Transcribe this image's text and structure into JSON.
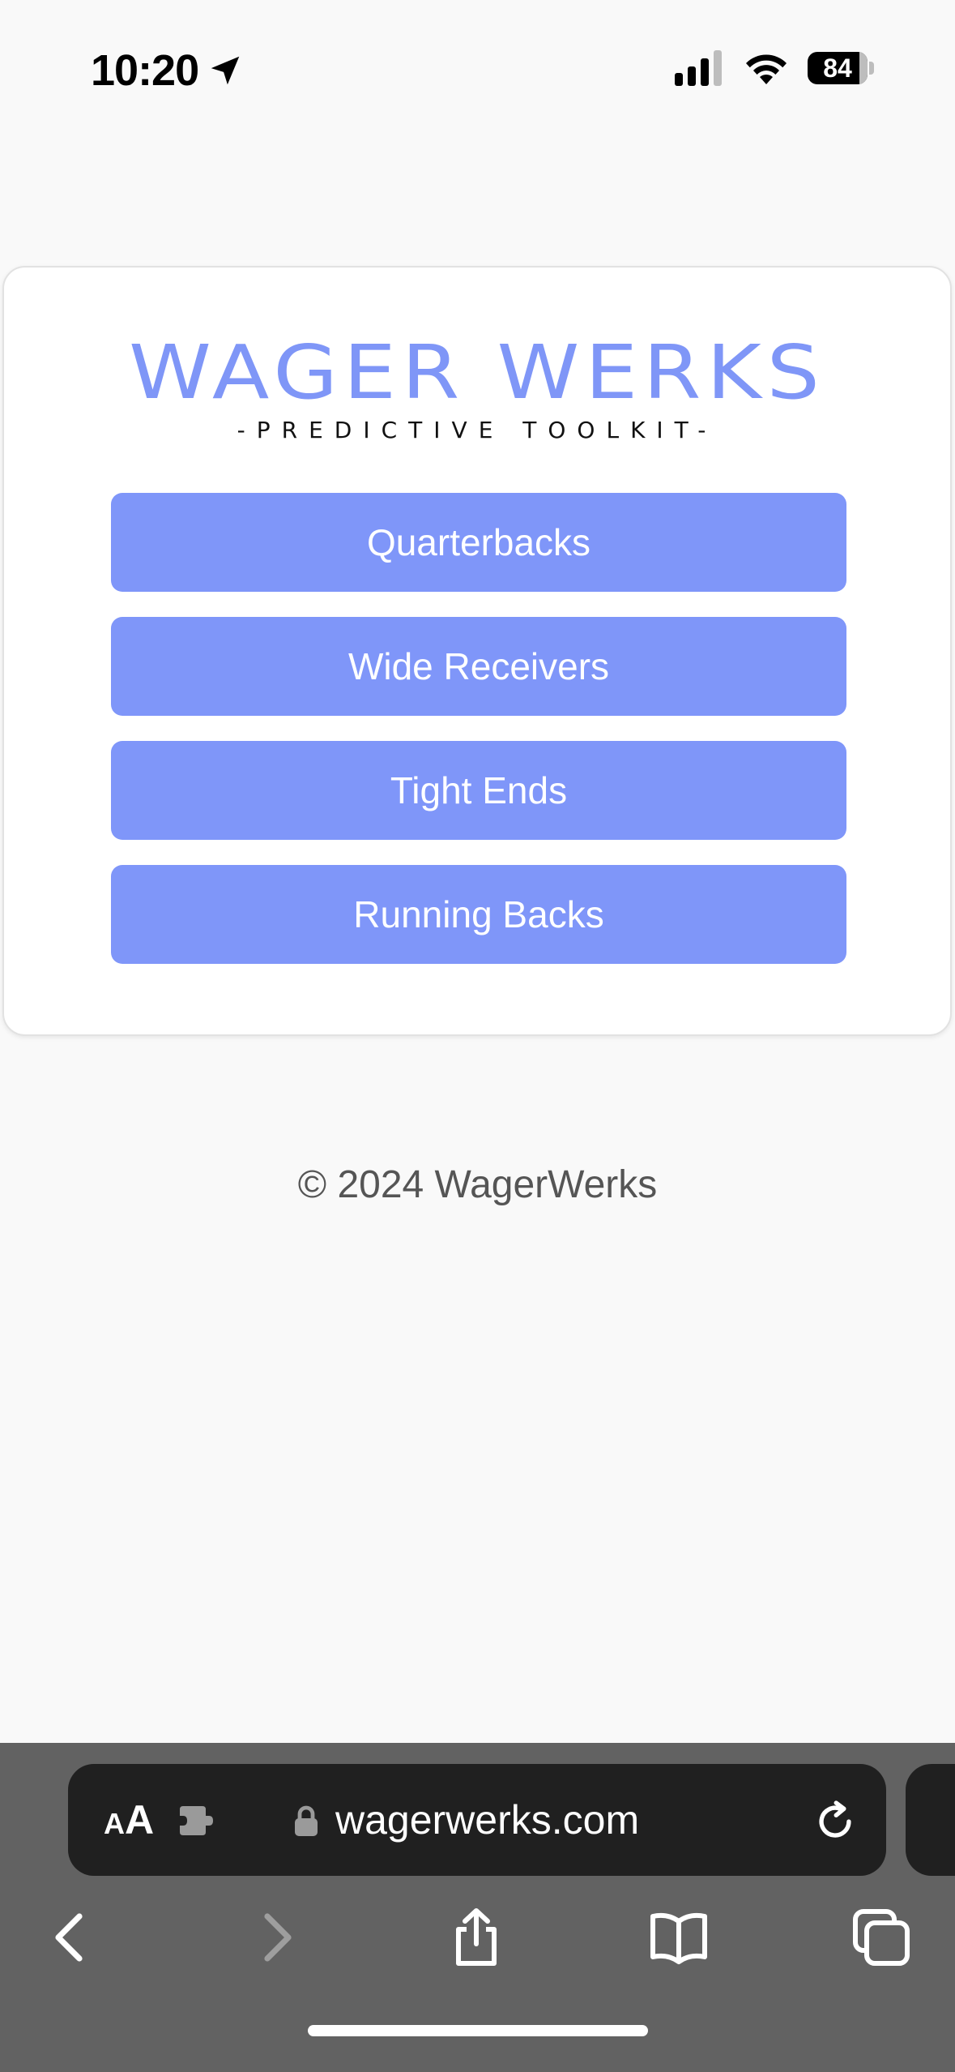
{
  "status_bar": {
    "time": "10:20",
    "battery_level": "84"
  },
  "logo": {
    "title": "WAGER WERKS",
    "subtitle": "-PREDICTIVE TOOLKIT-"
  },
  "menu": {
    "buttons": [
      {
        "label": "Quarterbacks"
      },
      {
        "label": "Wide Receivers"
      },
      {
        "label": "Tight Ends"
      },
      {
        "label": "Running Backs"
      }
    ]
  },
  "footer": {
    "copyright": "© 2024 WagerWerks"
  },
  "browser": {
    "reader_label_small": "A",
    "reader_label_large": "A",
    "url": "wagerwerks.com"
  },
  "colors": {
    "accent": "#7f96f9",
    "page_bg": "#f9f9f9",
    "chrome_bg": "#626262",
    "url_bar_bg": "#202020"
  }
}
